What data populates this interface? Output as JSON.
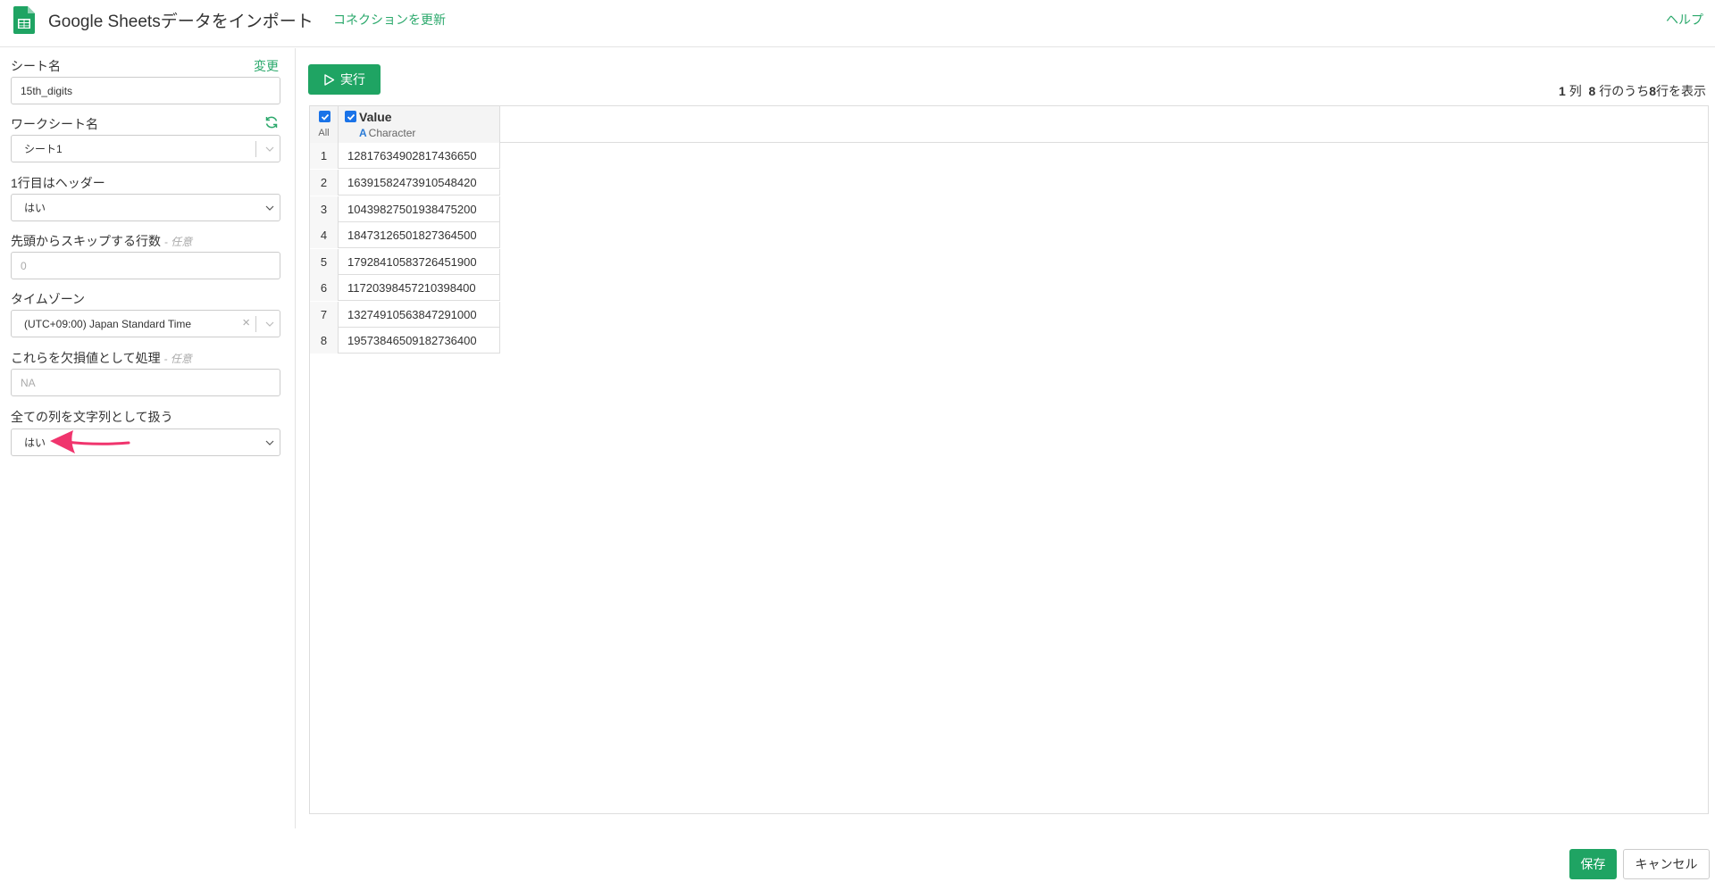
{
  "header": {
    "title": "Google Sheetsデータをインポート",
    "refresh_connection": "コネクションを更新",
    "help": "ヘルプ",
    "icon": "google-sheets-icon",
    "brand_color": "#1fa463"
  },
  "sidebar": {
    "sheet_name": {
      "label": "シート名",
      "action": "変更",
      "value": "15th_digits"
    },
    "worksheet_name": {
      "label": "ワークシート名",
      "value": "シート1",
      "icon": "sync-icon"
    },
    "header_row": {
      "label": "1行目はヘッダー",
      "value": "はい"
    },
    "skip_rows": {
      "label": "先頭からスキップする行数",
      "optional": "- 任意",
      "placeholder": "0"
    },
    "timezone": {
      "label": "タイムゾーン",
      "value": "(UTC+09:00) Japan Standard Time",
      "clear": "×"
    },
    "na_values": {
      "label": "これらを欠損値として処理",
      "optional": "- 任意",
      "placeholder": "NA"
    },
    "all_as_string": {
      "label": "全ての列を文字列として扱う",
      "value": "はい"
    }
  },
  "main": {
    "run_label": "実行",
    "summary": {
      "cols": "1",
      "cols_unit": "列",
      "total": "8",
      "mid": "行のうち",
      "shown": "8",
      "end": "行を表示"
    },
    "table": {
      "all_label": "All",
      "column": {
        "name": "Value",
        "type_icon": "A",
        "type": "Character"
      },
      "rows": [
        {
          "n": "1",
          "v": "12817634902817436650"
        },
        {
          "n": "2",
          "v": "16391582473910548420"
        },
        {
          "n": "3",
          "v": "10439827501938475200"
        },
        {
          "n": "4",
          "v": "18473126501827364500"
        },
        {
          "n": "5",
          "v": "17928410583726451900"
        },
        {
          "n": "6",
          "v": "11720398457210398400"
        },
        {
          "n": "7",
          "v": "13274910563847291000"
        },
        {
          "n": "8",
          "v": "19573846509182736400"
        }
      ]
    }
  },
  "footer": {
    "save": "保存",
    "cancel": "キャンセル"
  },
  "annotation": {
    "arrow_color": "#f0346d"
  }
}
